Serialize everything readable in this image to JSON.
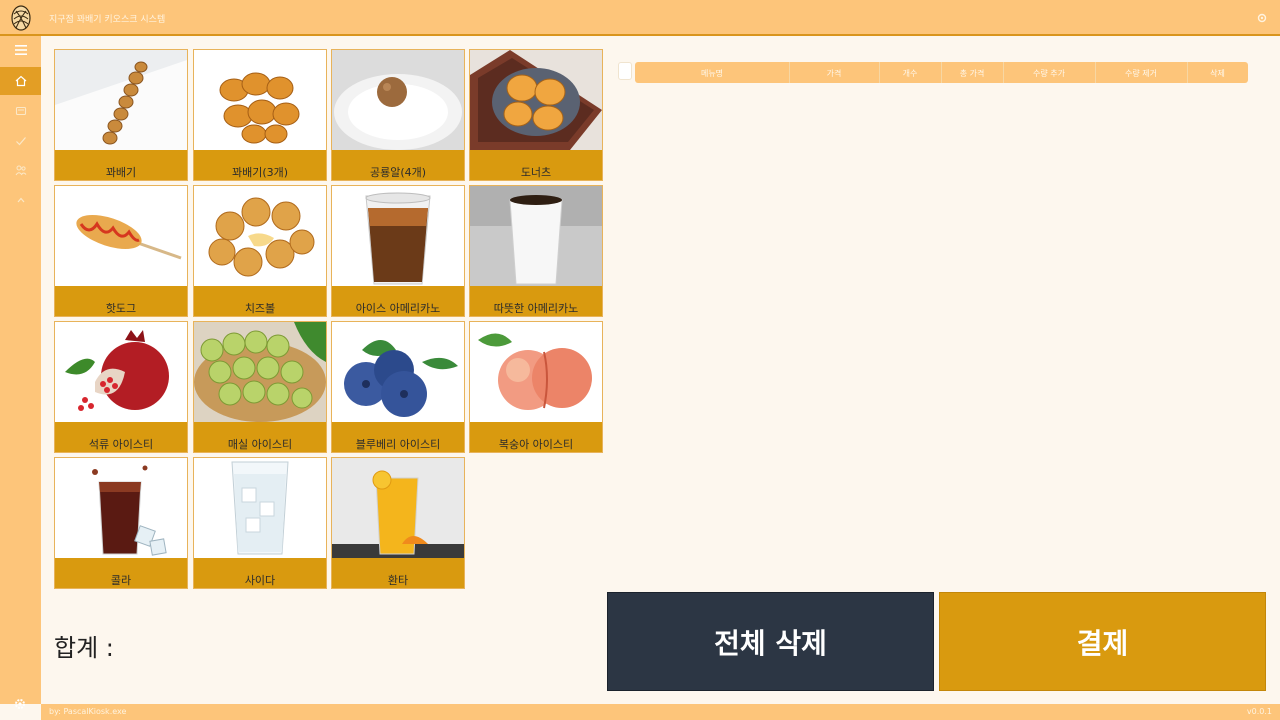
{
  "window": {
    "title": "지구점 꽈배기 키오스크 시스템",
    "logo_icon": "pretzel-logo-icon"
  },
  "sidebar": {
    "items": [
      {
        "name": "menu-toggle",
        "icon": "hamburger-icon"
      },
      {
        "name": "home",
        "icon": "home-icon",
        "active": true
      },
      {
        "name": "orders",
        "icon": "receipt-icon"
      },
      {
        "name": "checklist",
        "icon": "check-icon"
      },
      {
        "name": "staff",
        "icon": "people-icon"
      },
      {
        "name": "collapse",
        "icon": "chevron-up-icon"
      }
    ],
    "settings_icon": "gear-icon"
  },
  "menu": {
    "items": [
      {
        "label": "꽈배기",
        "image": "twisted-donut"
      },
      {
        "label": "꽈배기(3개)",
        "image": "twisted-donut-three"
      },
      {
        "label": "공룡알(4개)",
        "image": "dinosaur-egg"
      },
      {
        "label": "도너츠",
        "image": "donut"
      },
      {
        "label": "핫도그",
        "image": "corn-dog"
      },
      {
        "label": "치즈볼",
        "image": "cheese-ball"
      },
      {
        "label": "아이스 아메리카노",
        "image": "iced-americano"
      },
      {
        "label": "따뜻한 아메리카노",
        "image": "hot-americano"
      },
      {
        "label": "석류 아이스티",
        "image": "pomegranate"
      },
      {
        "label": "매실 아이스티",
        "image": "green-plum"
      },
      {
        "label": "블루베리 아이스티",
        "image": "blueberry"
      },
      {
        "label": "복숭아 아이스티",
        "image": "peach"
      },
      {
        "label": "콜라",
        "image": "cola"
      },
      {
        "label": "사이다",
        "image": "cider"
      },
      {
        "label": "환타",
        "image": "fanta"
      }
    ]
  },
  "order_table": {
    "columns": [
      "메뉴명",
      "가격",
      "개수",
      "총 가격",
      "수량 추가",
      "수량 제거",
      "삭제"
    ],
    "rows": []
  },
  "summary": {
    "total_label": "합계 :"
  },
  "actions": {
    "clear_all": "전체 삭제",
    "checkout": "결제"
  },
  "statusbar": {
    "left": "by: PascalKiosk.exe",
    "version": "v0.0.1"
  },
  "colors": {
    "accent": "#fdc57a",
    "button_gold": "#d99a0f",
    "button_dark": "#2c3644",
    "background": "#fdf7ee"
  }
}
